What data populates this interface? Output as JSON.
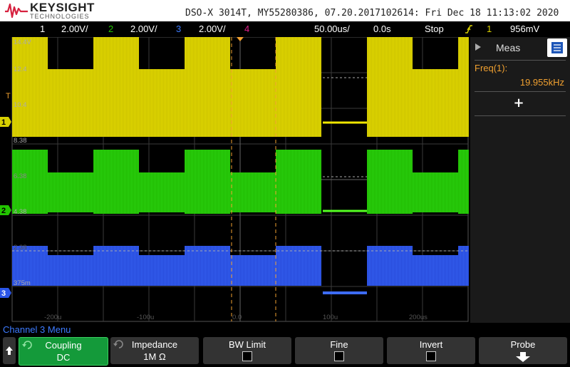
{
  "header": {
    "brand": "KEYSIGHT",
    "brand_sub": "TECHNOLOGIES",
    "model_info": "DSO-X 3014T, MY55280386, 07.20.2017102614: Fri Dec 18 11:13:02 2020"
  },
  "status": {
    "ch1_num": "1",
    "ch1_scale": "2.00V/",
    "ch2_num": "2",
    "ch2_scale": "2.00V/",
    "ch3_num": "3",
    "ch3_scale": "2.00V/",
    "ch4_num": "4",
    "timebase": "50.00us/",
    "delay": "0.0s",
    "run_state": "Stop",
    "trigger_source": "1",
    "trigger_level": "956mV"
  },
  "colors": {
    "ch1": "#d8d000",
    "ch2": "#22c400",
    "ch3": "#2a55e8",
    "ch4": "#e0208a",
    "cursor": "#f0a030",
    "menu_blue": "#1e56b8",
    "softkey_active": "#149a3a"
  },
  "grid_labels": {
    "v1": "14.4V",
    "v2": "12.4",
    "v3": "10.4",
    "v4": "8.38",
    "v5": "6.38",
    "v6": "4.38",
    "v7": "2.38",
    "v8": "375m",
    "t1": "-200u",
    "t2": "-100u",
    "t3": "0.0",
    "t4": "100u",
    "t5": "200us"
  },
  "markers": {
    "trigger": "T",
    "ch1": "1",
    "ch2": "2",
    "ch3": "3"
  },
  "measurements": {
    "title": "Meas",
    "freq_label": "Freq(1):",
    "freq_value": "19.955kHz",
    "add_symbol": "+"
  },
  "menu": {
    "title": "Channel 3 Menu",
    "softkeys": [
      {
        "label": "Coupling",
        "value": "DC"
      },
      {
        "label": "Impedance",
        "value": "1M Ω"
      },
      {
        "label": "BW Limit"
      },
      {
        "label": "Fine"
      },
      {
        "label": "Invert"
      },
      {
        "label": "Probe"
      }
    ]
  }
}
